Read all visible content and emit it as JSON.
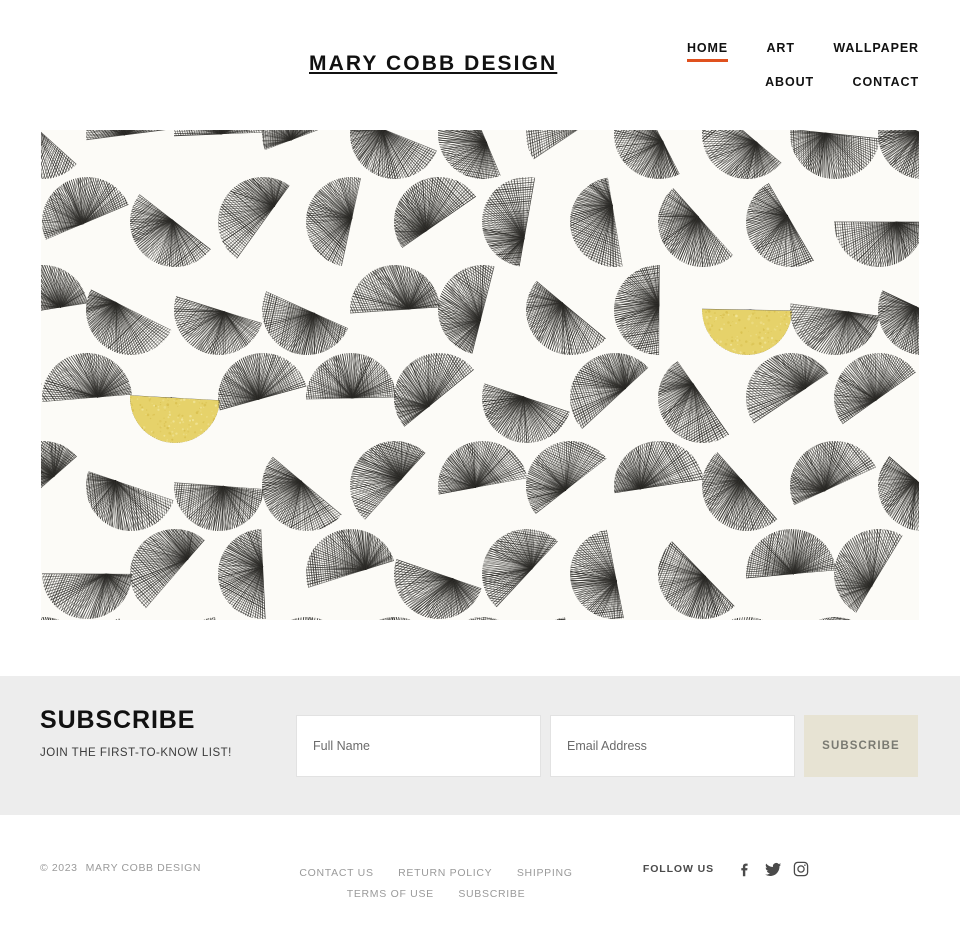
{
  "site": {
    "logo": "MARY COBB DESIGN",
    "accent_color": "#e0511e",
    "band_color": "#ededed",
    "button_color": "#e7e3d3",
    "hero_yellow": "#e6d26a"
  },
  "nav": {
    "row1": [
      {
        "label": "HOME",
        "active": true
      },
      {
        "label": "ART",
        "active": false
      },
      {
        "label": "WALLPAPER",
        "active": false
      }
    ],
    "row2": [
      {
        "label": "ABOUT",
        "active": false
      },
      {
        "label": "CONTACT",
        "active": false
      }
    ]
  },
  "hero": {
    "alt": "abstract hand-drawn circles with radiating ink hatching and two yellow half-circles"
  },
  "subscribe": {
    "title": "SUBSCRIBE",
    "subtitle": "JOIN THE FIRST-TO-KNOW LIST!",
    "name_placeholder": "Full Name",
    "name_value": "",
    "email_placeholder": "Email Address",
    "email_value": "",
    "button_label": "SUBSCRIBE"
  },
  "footer": {
    "copyright_year": "© 2023",
    "copyright_name": "MARY COBB DESIGN",
    "links": [
      "CONTACT US",
      "RETURN POLICY",
      "SHIPPING",
      "TERMS OF USE",
      "SUBSCRIBE"
    ],
    "follow_label": "FOLLOW US",
    "social": [
      {
        "name": "facebook-icon"
      },
      {
        "name": "twitter-icon"
      },
      {
        "name": "instagram-icon"
      }
    ]
  }
}
